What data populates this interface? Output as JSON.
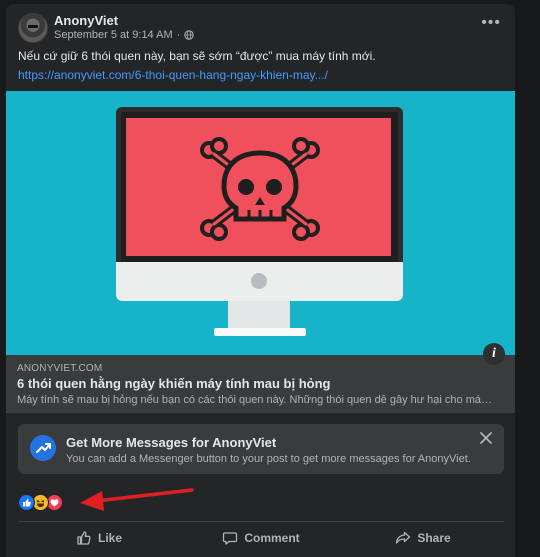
{
  "post": {
    "author": "AnonyViet",
    "timestamp": "September 5 at 9:14 AM",
    "more_label": "•••",
    "message": "Nếu cứ giữ 6 thói quen này, bạn sẽ sớm “được” mua máy tính mới.",
    "link_text": "https://anonyviet.com/6-thoi-quen-hang-ngay-khien-may.../"
  },
  "link_preview": {
    "domain": "ANONYVIET.COM",
    "title": "6 thói quen hằng ngày khiến máy tính mau bị hỏng",
    "description": "Máy tính sẽ mau bị hỏng nếu bạn có các thói quen này. Những thói quen dễ gây hư hại cho máy tín…",
    "info_label": "i",
    "image_bg": "#17b3c9",
    "screen_color": "#f0505b"
  },
  "promo": {
    "title": "Get More Messages for AnonyViet",
    "subtitle": "You can add a Messenger button to your post to get more messages for AnonyViet."
  },
  "reactions": [
    "like",
    "haha",
    "love"
  ],
  "actions": {
    "like": "Like",
    "comment": "Comment",
    "share": "Share"
  },
  "colors": {
    "background": "#18191a",
    "card": "#242526",
    "link": "#4599ff",
    "accent": "#2374e1",
    "annotation_arrow": "#e02020"
  }
}
